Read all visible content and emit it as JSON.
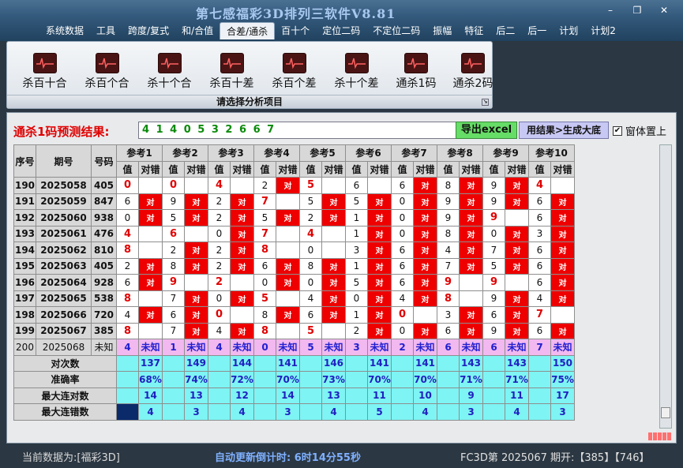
{
  "app": {
    "title": "第七感福彩3D排列三软件V8.81"
  },
  "window_controls": {
    "minimize": "–",
    "restore": "❐",
    "close": "✕"
  },
  "menu": [
    "系统数据",
    "工具",
    "跨度/复式",
    "和/合值",
    "合差/通杀",
    "百十个",
    "定位二码",
    "不定位二码",
    "振幅",
    "特征",
    "后二",
    "后一",
    "计划",
    "计划2"
  ],
  "menu_active_index": 4,
  "ribbon": {
    "buttons": [
      "杀百十合",
      "杀百个合",
      "杀十个合",
      "杀百十差",
      "杀百个差",
      "杀十个差",
      "通杀1码",
      "通杀2码"
    ],
    "caption": "请选择分析项目",
    "expand": "↘"
  },
  "result": {
    "label": "通杀1码预测结果:",
    "value": "4 1 4 0 5 3 2 6 6 7",
    "export": "导出excel",
    "generate": "用结果>生成大底",
    "topmost_label": "窗体置上",
    "topmost_checked": "✔"
  },
  "grid": {
    "headers": {
      "seq": "序号",
      "issue": "期号",
      "code": "号码",
      "value": "值",
      "result": "对错"
    },
    "refs": [
      "参考1",
      "参考2",
      "参考3",
      "参考4",
      "参考5",
      "参考6",
      "参考7",
      "参考8",
      "参考9",
      "参考10"
    ],
    "rows": [
      {
        "seq": "190",
        "issue": "2025058",
        "code": "405",
        "vals": [
          "0",
          "0",
          "4",
          "2",
          "5",
          "6",
          "6",
          "8",
          "9",
          "4"
        ],
        "hit": [
          0,
          0,
          0,
          1,
          0,
          0,
          1,
          1,
          1,
          0
        ],
        "red": [
          1,
          1,
          1,
          0,
          1,
          0,
          0,
          0,
          0,
          1
        ]
      },
      {
        "seq": "191",
        "issue": "2025059",
        "code": "847",
        "vals": [
          "6",
          "9",
          "2",
          "7",
          "5",
          "5",
          "0",
          "9",
          "9",
          "6"
        ],
        "hit": [
          1,
          1,
          1,
          0,
          1,
          1,
          1,
          1,
          1,
          1
        ],
        "red": [
          0,
          0,
          0,
          1,
          0,
          0,
          0,
          0,
          0,
          0
        ]
      },
      {
        "seq": "192",
        "issue": "2025060",
        "code": "938",
        "vals": [
          "0",
          "5",
          "2",
          "5",
          "2",
          "1",
          "0",
          "9",
          "9",
          "6"
        ],
        "hit": [
          1,
          1,
          1,
          1,
          1,
          1,
          1,
          1,
          0,
          1
        ],
        "red": [
          0,
          0,
          0,
          0,
          0,
          0,
          0,
          0,
          1,
          0
        ]
      },
      {
        "seq": "193",
        "issue": "2025061",
        "code": "476",
        "vals": [
          "4",
          "6",
          "0",
          "7",
          "4",
          "1",
          "0",
          "8",
          "0",
          "3"
        ],
        "hit": [
          0,
          0,
          1,
          0,
          0,
          1,
          1,
          1,
          1,
          1
        ],
        "red": [
          1,
          1,
          0,
          1,
          1,
          0,
          0,
          0,
          0,
          0
        ]
      },
      {
        "seq": "194",
        "issue": "2025062",
        "code": "810",
        "vals": [
          "8",
          "2",
          "2",
          "8",
          "0",
          "3",
          "6",
          "4",
          "7",
          "6"
        ],
        "hit": [
          0,
          1,
          1,
          0,
          0,
          1,
          1,
          1,
          1,
          1
        ],
        "red": [
          1,
          0,
          0,
          1,
          0,
          0,
          0,
          0,
          0,
          0
        ]
      },
      {
        "seq": "195",
        "issue": "2025063",
        "code": "405",
        "vals": [
          "2",
          "8",
          "2",
          "6",
          "8",
          "1",
          "6",
          "7",
          "5",
          "6"
        ],
        "hit": [
          1,
          1,
          1,
          1,
          1,
          1,
          1,
          1,
          1,
          1
        ],
        "red": [
          0,
          0,
          0,
          0,
          0,
          0,
          0,
          0,
          0,
          0
        ]
      },
      {
        "seq": "196",
        "issue": "2025064",
        "code": "928",
        "vals": [
          "6",
          "9",
          "2",
          "0",
          "0",
          "5",
          "6",
          "9",
          "9",
          "6"
        ],
        "hit": [
          1,
          0,
          0,
          1,
          1,
          1,
          1,
          0,
          0,
          1
        ],
        "red": [
          0,
          1,
          1,
          0,
          0,
          0,
          0,
          1,
          1,
          0
        ]
      },
      {
        "seq": "197",
        "issue": "2025065",
        "code": "538",
        "vals": [
          "8",
          "7",
          "0",
          "5",
          "4",
          "0",
          "4",
          "8",
          "9",
          "4"
        ],
        "hit": [
          0,
          1,
          1,
          0,
          1,
          1,
          1,
          0,
          1,
          1
        ],
        "red": [
          1,
          0,
          0,
          1,
          0,
          0,
          0,
          1,
          0,
          0
        ]
      },
      {
        "seq": "198",
        "issue": "2025066",
        "code": "720",
        "vals": [
          "4",
          "6",
          "0",
          "8",
          "6",
          "1",
          "0",
          "3",
          "6",
          "7"
        ],
        "hit": [
          1,
          1,
          0,
          1,
          1,
          1,
          0,
          1,
          1,
          0
        ],
        "red": [
          0,
          0,
          1,
          0,
          0,
          0,
          1,
          0,
          0,
          1
        ]
      },
      {
        "seq": "199",
        "issue": "2025067",
        "code": "385",
        "vals": [
          "8",
          "7",
          "4",
          "8",
          "5",
          "2",
          "0",
          "6",
          "9",
          "6"
        ],
        "hit": [
          0,
          1,
          1,
          0,
          0,
          1,
          1,
          1,
          1,
          1
        ],
        "red": [
          1,
          0,
          0,
          1,
          1,
          0,
          0,
          0,
          0,
          0
        ]
      }
    ],
    "pred_row": {
      "seq": "200",
      "issue": "2025068",
      "code": "未知",
      "vals": [
        "4",
        "1",
        "4",
        "0",
        "5",
        "3",
        "2",
        "6",
        "6",
        "7"
      ],
      "unknown": "未知"
    },
    "stats": [
      {
        "label": "对次数",
        "vals": [
          "137",
          "149",
          "144",
          "141",
          "146",
          "141",
          "141",
          "143",
          "143",
          "150"
        ]
      },
      {
        "label": "准确率",
        "vals": [
          "68%",
          "74%",
          "72%",
          "70%",
          "73%",
          "70%",
          "70%",
          "71%",
          "71%",
          "75%"
        ]
      },
      {
        "label": "最大连对数",
        "vals": [
          "14",
          "13",
          "12",
          "14",
          "13",
          "11",
          "10",
          "9",
          "11",
          "17"
        ]
      },
      {
        "label": "最大连错数",
        "vals": [
          "4",
          "3",
          "4",
          "3",
          "4",
          "5",
          "4",
          "3",
          "4",
          "3"
        ]
      }
    ],
    "hit_mark": "对"
  },
  "status": {
    "current": "当前数据为:[福彩3D]",
    "update": "自动更新倒计时:  6时14分55秒",
    "issue": "FC3D第 2025067 期开:【385】【746】"
  }
}
